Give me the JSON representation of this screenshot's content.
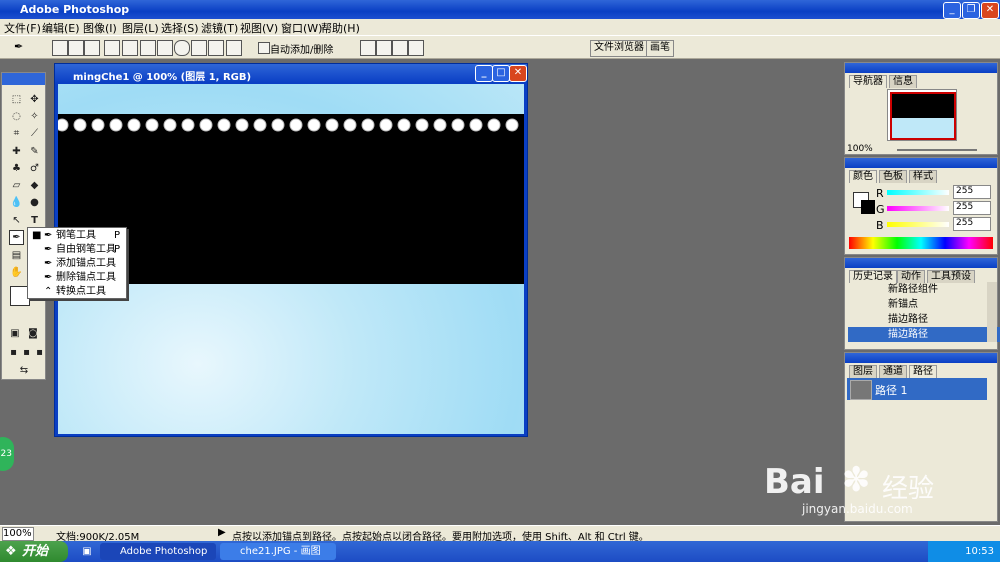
{
  "app": {
    "title": "Adobe Photoshop"
  },
  "menu": [
    "文件(F)",
    "编辑(E)",
    "图像(I)",
    "图层(L)",
    "选择(S)",
    "滤镜(T)",
    "视图(V)",
    "窗口(W)",
    "帮助(H)"
  ],
  "options": {
    "auto_add_delete": "自动添加/删除",
    "file_browser": "文件浏览器",
    "brushes": "画笔"
  },
  "document": {
    "title": "mingChe1 @ 100% (图层 1, RGB)"
  },
  "flyout": {
    "items": [
      {
        "label": "钢笔工具",
        "key": "P"
      },
      {
        "label": "自由钢笔工具",
        "key": "P"
      },
      {
        "label": "添加锚点工具",
        "key": ""
      },
      {
        "label": "删除锚点工具",
        "key": ""
      },
      {
        "label": "转换点工具",
        "key": ""
      }
    ]
  },
  "navigator": {
    "tabs": [
      "导航器",
      "信息"
    ],
    "zoom": "100%"
  },
  "color": {
    "tabs": [
      "颜色",
      "色板",
      "样式"
    ],
    "channels": [
      {
        "name": "R",
        "value": "255"
      },
      {
        "name": "G",
        "value": "255"
      },
      {
        "name": "B",
        "value": "255"
      }
    ]
  },
  "history": {
    "tabs": [
      "历史记录",
      "动作",
      "工具预设"
    ],
    "items": [
      "新路径组件",
      "新锚点",
      "描边路径",
      "描边路径"
    ]
  },
  "layers": {
    "tabs": [
      "图层",
      "通道",
      "路径"
    ],
    "path_name": "路径 1"
  },
  "status": {
    "zoom": "100%",
    "doc": "文档:900K/2.05M",
    "hint": "点按以添加锚点到路径。点按起始点以闭合路径。要用附加选项，使用 Shift、Alt 和 Ctrl 键。"
  },
  "taskbar": {
    "start": "开始",
    "task1": "Adobe Photoshop",
    "task2": "che21.JPG - 画图",
    "clock": "10:53"
  },
  "badge": "23",
  "watermark": {
    "brand": "Bai",
    "brand2": "经验",
    "url": "jingyan.baidu.com"
  }
}
